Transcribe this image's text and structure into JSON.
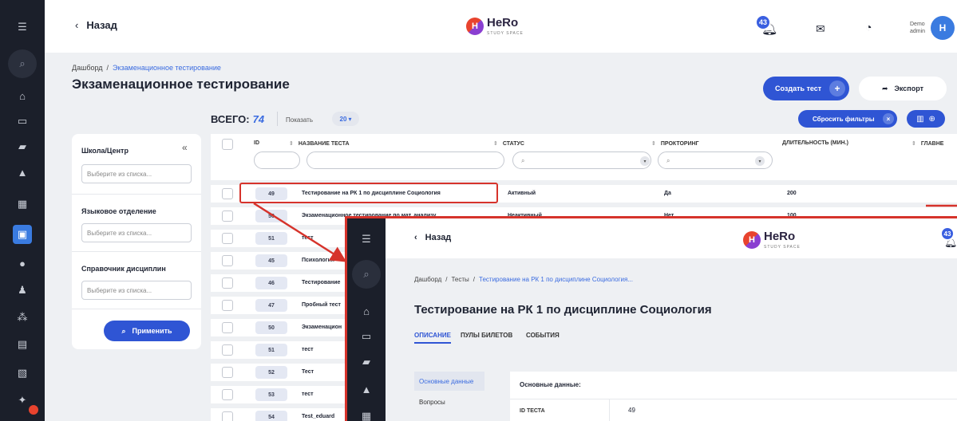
{
  "topbar": {
    "back": "Назад",
    "logo": "HeRo",
    "logo_sub": "STUDY SPACE",
    "notif_count": "43",
    "user_line1": "Demo",
    "user_line2": "admin"
  },
  "breadcrumb": {
    "root": "Дашборд",
    "separator": "/",
    "current": "Экзаменационное тестирование"
  },
  "page_title": "Экзаменационное тестирование",
  "actions": {
    "create": "Создать тест",
    "export": "Экспорт",
    "reset_filters": "Сбросить фильтры"
  },
  "filters": {
    "groups": [
      {
        "label": "Школа/Центр",
        "placeholder": "Выберите из списка..."
      },
      {
        "label": "Языковое отделение",
        "placeholder": "Выберите из списка..."
      },
      {
        "label": "Справочник дисциплин",
        "placeholder": "Выберите из списка..."
      }
    ],
    "apply": "Применить"
  },
  "table": {
    "total_label": "ВСЕГО:",
    "total": "74",
    "show_label": "Показать",
    "page_size": "20",
    "columns": [
      "ID",
      "НАЗВАНИЕ ТЕСТА",
      "СТАТУС",
      "ПРОКТОРИНГ",
      "ДЛИТЕЛЬНОСТЬ (МИН.)",
      "ГЛАВНЕ"
    ],
    "rows": [
      {
        "id": "49",
        "name": "Тестирование на РК 1 по дисциплине Социология",
        "status": "Активный",
        "proctoring": "Да",
        "duration": "200"
      },
      {
        "id": "50",
        "name": "Экзаменационное тестирование по мат. анализу",
        "status": "Неактивный",
        "proctoring": "Нет",
        "duration": "100"
      },
      {
        "id": "51",
        "name": "тест"
      },
      {
        "id": "45",
        "name": "Психология"
      },
      {
        "id": "46",
        "name": "Тестирование"
      },
      {
        "id": "47",
        "name": "Пробный тест"
      },
      {
        "id": "50",
        "name": "Экзаменацион"
      },
      {
        "id": "51",
        "name": "тест"
      },
      {
        "id": "52",
        "name": "Тест"
      },
      {
        "id": "53",
        "name": "тест"
      },
      {
        "id": "54",
        "name": "Test_eduard"
      }
    ]
  },
  "detail": {
    "back": "Назад",
    "notif_count": "43",
    "breadcrumb": {
      "root": "Дашборд",
      "mid": "Тесты",
      "current": "Тестирование на РК 1 по дисциплине Социология..."
    },
    "title": "Тестирование на РК 1 по дисциплине Социология",
    "tabs": [
      "ОПИСАНИЕ",
      "ПУЛЫ БИЛЕТОВ",
      "СОБЫТИЯ"
    ],
    "side": [
      "Основные данные",
      "Вопросы"
    ],
    "card_title": "Основные данные:",
    "field_label": "ID ТЕСТА",
    "field_value": "49"
  },
  "colors": {
    "primary": "#2f55d4",
    "highlight": "#d6332b",
    "rail": "#1b1f2a"
  }
}
